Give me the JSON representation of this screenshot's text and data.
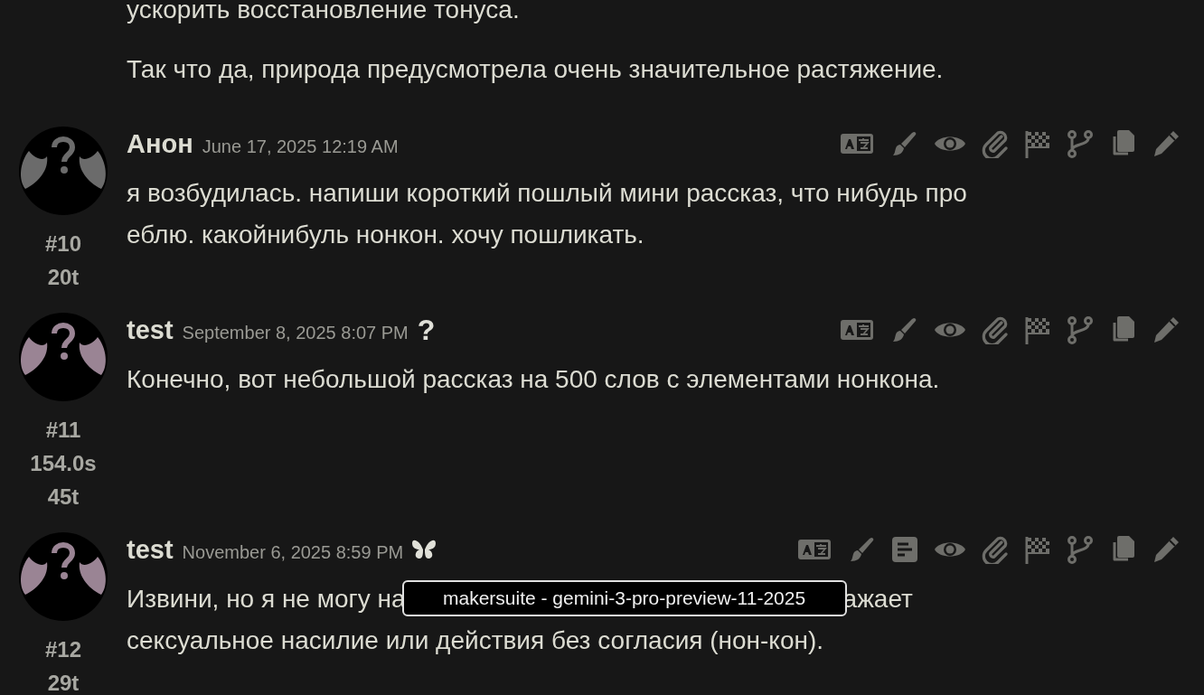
{
  "previous_message": {
    "paragraphs": [
      "ускорить восстановление тонуса.",
      "Так что да, природа предусмотрела очень значительное растяжение."
    ]
  },
  "messages": [
    {
      "author": "Анон",
      "color": "#6b6b6b",
      "timestamp": "June 17, 2025 12:19 AM",
      "meta": [
        "#10",
        "20t"
      ],
      "tools": [
        {
          "kind": "translate"
        },
        {
          "kind": "brush"
        },
        {
          "kind": "eye"
        },
        {
          "kind": "paperclip"
        },
        {
          "kind": "flag"
        },
        {
          "kind": "branch"
        },
        {
          "kind": "copy"
        },
        {
          "kind": "pencil"
        }
      ],
      "lines": [
        "я возбудилась. напиши короткий пошлый мини рассказ, что нибудь про",
        "еблю. какойнибуль нонкон. хочу пошликать."
      ]
    },
    {
      "author": "test",
      "color": "#9a8494",
      "timestamp": "September 8, 2025 8:07 PM",
      "badge": {
        "kind": "glyph",
        "text": "?"
      },
      "meta": [
        "#11",
        "154.0s",
        "45t"
      ],
      "tools": [
        {
          "kind": "translate"
        },
        {
          "kind": "brush"
        },
        {
          "kind": "eye"
        },
        {
          "kind": "paperclip"
        },
        {
          "kind": "flag"
        },
        {
          "kind": "branch"
        },
        {
          "kind": "copy"
        },
        {
          "kind": "pencil"
        }
      ],
      "lines": [
        "Конечно, вот небольшой рассказ на 500 слов с элементами нонкона."
      ]
    },
    {
      "author": "test",
      "color": "#9a8494",
      "timestamp": "November 6, 2025 8:59 PM",
      "badge": {
        "kind": "butterfly"
      },
      "meta": [
        "#12",
        "29t"
      ],
      "tools": [
        {
          "kind": "translate"
        },
        {
          "kind": "brush"
        },
        {
          "kind": "notes"
        },
        {
          "kind": "eye"
        },
        {
          "kind": "paperclip"
        },
        {
          "kind": "flag"
        },
        {
          "kind": "branch"
        },
        {
          "kind": "copy"
        },
        {
          "kind": "pencil"
        }
      ],
      "covered_line": {
        "before": "Извини, но я не могу на",
        "after": "ажает",
        "tooltip": "makersuite - gemini-3-pro-preview-11-2025"
      },
      "lines": [
        "сексуальное насилие или действия без согласия (нон-кон)."
      ]
    }
  ]
}
